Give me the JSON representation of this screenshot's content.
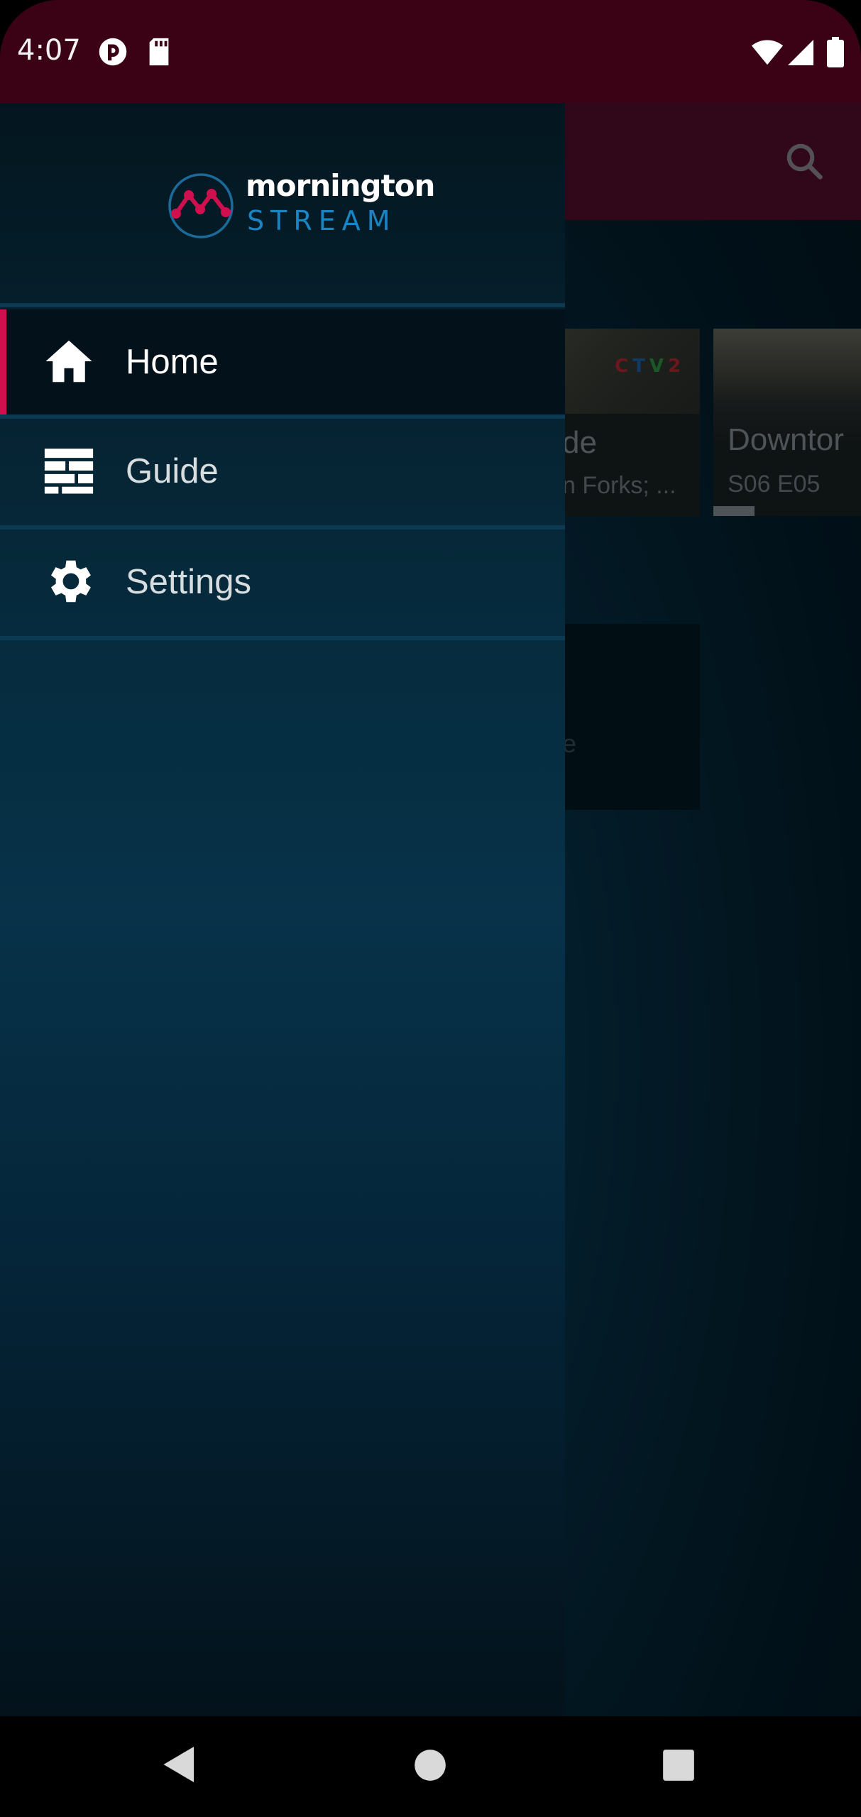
{
  "status_bar": {
    "time": "4:07",
    "icons": [
      "notification-app-icon",
      "sd-card-icon",
      "wifi-icon",
      "cellular-signal-icon",
      "battery-icon"
    ]
  },
  "toolbar": {
    "search_icon": "search-icon",
    "color": "#5a0624"
  },
  "content_row": {
    "cards": [
      {
        "title": "de",
        "subtitle": "n Forks; ...",
        "channel_logo": "CTV"
      },
      {
        "title": "Downtor",
        "subtitle": "S06 E05",
        "progress": 0.28
      }
    ],
    "placeholder_text": "e"
  },
  "drawer": {
    "logo": {
      "line1": "mornington",
      "line2": "STREAM"
    },
    "items": [
      {
        "label": "Home",
        "icon": "home-icon",
        "active": true
      },
      {
        "label": "Guide",
        "icon": "guide-icon",
        "active": false
      },
      {
        "label": "Settings",
        "icon": "settings-icon",
        "active": false
      }
    ],
    "accent_color": "#d0104e"
  },
  "nav_bar": {
    "buttons": [
      "back-button",
      "home-button",
      "recents-button"
    ]
  }
}
